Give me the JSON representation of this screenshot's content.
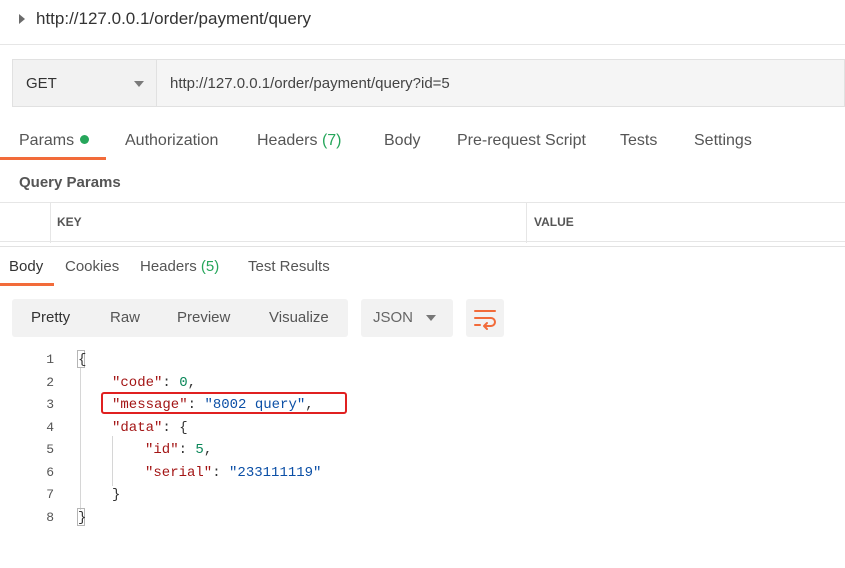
{
  "window": {
    "title": "http://127.0.0.1/order/payment/query"
  },
  "request": {
    "method": "GET",
    "url": "http://127.0.0.1/order/payment/query?id=5"
  },
  "request_tabs": [
    {
      "label": "Params",
      "active": true,
      "dot": true
    },
    {
      "label": "Authorization"
    },
    {
      "label": "Headers",
      "count": "(7)"
    },
    {
      "label": "Body"
    },
    {
      "label": "Pre-request Script"
    },
    {
      "label": "Tests"
    },
    {
      "label": "Settings"
    }
  ],
  "query_params": {
    "label": "Query Params",
    "columns": [
      "KEY",
      "VALUE"
    ]
  },
  "response_tabs": [
    {
      "label": "Body",
      "active": true
    },
    {
      "label": "Cookies"
    },
    {
      "label": "Headers",
      "count": "(5)"
    },
    {
      "label": "Test Results"
    }
  ],
  "view_modes": [
    "Pretty",
    "Raw",
    "Preview",
    "Visualize"
  ],
  "format": "JSON",
  "icons": {
    "wrap": "wrap-lines-icon",
    "collapse": "caret-right-icon",
    "dropdown": "chevron-down-icon"
  },
  "colors": {
    "accent": "#f26b3a",
    "success": "#26a65b",
    "highlight": "#e02020"
  },
  "code": {
    "line_numbers": [
      "1",
      "2",
      "3",
      "4",
      "5",
      "6",
      "7",
      "8"
    ],
    "open_brace": "{",
    "close_brace": "}",
    "code_key": "\"code\"",
    "code_value": "0",
    "message_key": "\"message\"",
    "message_value": "\"8002 query\"",
    "data_key": "\"data\"",
    "data_open": "{",
    "id_key": "\"id\"",
    "id_value": "5",
    "serial_key": "\"serial\"",
    "serial_value": "\"233111119\"",
    "data_close": "}",
    "colon": ": ",
    "comma": ","
  }
}
